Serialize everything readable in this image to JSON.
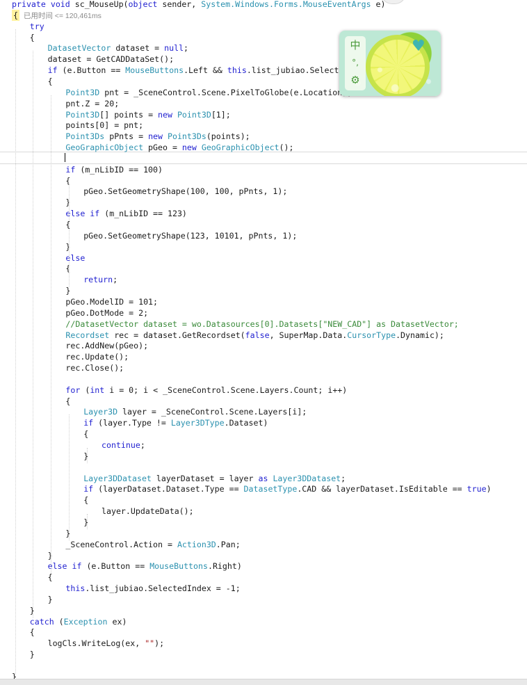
{
  "editor": {
    "inline_hint": "已用时间 <= 120,461ms",
    "lines": [
      {
        "indent": 0,
        "parts": [
          [
            "kw",
            "private void "
          ],
          [
            "",
            "sc_MouseUp("
          ],
          [
            "kw",
            "object"
          ],
          [
            "",
            " sender, "
          ],
          [
            "ty",
            "System.Windows.Forms.MouseEventArgs"
          ],
          [
            "",
            " e)"
          ]
        ]
      },
      {
        "indent": 0,
        "hint": true
      },
      {
        "indent": 1,
        "parts": [
          [
            "kw",
            "try"
          ]
        ]
      },
      {
        "indent": 1,
        "parts": [
          [
            "",
            "{"
          ]
        ]
      },
      {
        "indent": 2,
        "parts": [
          [
            "ty",
            "DatasetVector"
          ],
          [
            "",
            " dataset = "
          ],
          [
            "kw",
            "null"
          ],
          [
            "",
            ";"
          ]
        ]
      },
      {
        "indent": 2,
        "parts": [
          [
            "",
            "dataset = GetCADDataSet();"
          ]
        ]
      },
      {
        "indent": 2,
        "parts": [
          [
            "kw",
            "if"
          ],
          [
            "",
            " (e.Button == "
          ],
          [
            "ty",
            "MouseButtons"
          ],
          [
            "",
            ".Left && "
          ],
          [
            "kw",
            "this"
          ],
          [
            "",
            ".list_jubiao.SelectedInd"
          ]
        ]
      },
      {
        "indent": 2,
        "parts": [
          [
            "",
            "{"
          ]
        ]
      },
      {
        "indent": 3,
        "parts": [
          [
            "ty",
            "Point3D"
          ],
          [
            "",
            " pnt = _SceneControl.Scene.PixelToGlobe(e.Location);"
          ]
        ]
      },
      {
        "indent": 3,
        "parts": [
          [
            "",
            "pnt.Z = 20;"
          ]
        ]
      },
      {
        "indent": 3,
        "parts": [
          [
            "ty",
            "Point3D"
          ],
          [
            "",
            "[] points = "
          ],
          [
            "kw",
            "new "
          ],
          [
            "ty",
            "Point3D"
          ],
          [
            "",
            "[1];"
          ]
        ]
      },
      {
        "indent": 3,
        "parts": [
          [
            "",
            "points[0] = pnt;"
          ]
        ]
      },
      {
        "indent": 3,
        "parts": [
          [
            "ty",
            "Point3Ds"
          ],
          [
            "",
            " pPnts = "
          ],
          [
            "kw",
            "new "
          ],
          [
            "ty",
            "Point3Ds"
          ],
          [
            "",
            "(points);"
          ]
        ]
      },
      {
        "indent": 3,
        "parts": [
          [
            "ty",
            "GeoGraphicObject"
          ],
          [
            "",
            " pGeo = "
          ],
          [
            "kw",
            "new "
          ],
          [
            "ty",
            "GeoGraphicObject"
          ],
          [
            "",
            "();"
          ]
        ]
      },
      {
        "indent": 3,
        "parts": []
      },
      {
        "indent": 3,
        "parts": [
          [
            "kw",
            "if"
          ],
          [
            "",
            " (m_nLibID == 100)"
          ]
        ]
      },
      {
        "indent": 3,
        "parts": [
          [
            "",
            "{"
          ]
        ]
      },
      {
        "indent": 4,
        "parts": [
          [
            "",
            "pGeo.SetGeometryShape(100, 100, pPnts, 1);"
          ]
        ]
      },
      {
        "indent": 3,
        "parts": [
          [
            "",
            "}"
          ]
        ]
      },
      {
        "indent": 3,
        "parts": [
          [
            "kw",
            "else if"
          ],
          [
            "",
            " (m_nLibID == 123)"
          ]
        ]
      },
      {
        "indent": 3,
        "parts": [
          [
            "",
            "{"
          ]
        ]
      },
      {
        "indent": 4,
        "parts": [
          [
            "",
            "pGeo.SetGeometryShape(123, 10101, pPnts, 1);"
          ]
        ]
      },
      {
        "indent": 3,
        "parts": [
          [
            "",
            "}"
          ]
        ]
      },
      {
        "indent": 3,
        "parts": [
          [
            "kw",
            "else"
          ]
        ]
      },
      {
        "indent": 3,
        "parts": [
          [
            "",
            "{"
          ]
        ]
      },
      {
        "indent": 4,
        "parts": [
          [
            "kw",
            "return"
          ],
          [
            "",
            ";"
          ]
        ]
      },
      {
        "indent": 3,
        "parts": [
          [
            "",
            "}"
          ]
        ]
      },
      {
        "indent": 3,
        "parts": [
          [
            "",
            "pGeo.ModelID = 101;"
          ]
        ]
      },
      {
        "indent": 3,
        "parts": [
          [
            "",
            "pGeo.DotMode = 2;"
          ]
        ]
      },
      {
        "indent": 3,
        "parts": [
          [
            "cm",
            "//DatasetVector dataset = wo.Datasources[0].Datasets[\"NEW_CAD\"] as DatasetVector;"
          ]
        ]
      },
      {
        "indent": 3,
        "parts": [
          [
            "ty",
            "Recordset"
          ],
          [
            "",
            " rec = dataset.GetRecordset("
          ],
          [
            "kw",
            "false"
          ],
          [
            "",
            ", SuperMap.Data."
          ],
          [
            "ty",
            "CursorType"
          ],
          [
            "",
            ".Dynamic);"
          ]
        ]
      },
      {
        "indent": 3,
        "parts": [
          [
            "",
            "rec.AddNew(pGeo);"
          ]
        ]
      },
      {
        "indent": 3,
        "parts": [
          [
            "",
            "rec.Update();"
          ]
        ]
      },
      {
        "indent": 3,
        "parts": [
          [
            "",
            "rec.Close();"
          ]
        ]
      },
      {
        "indent": 3,
        "parts": []
      },
      {
        "indent": 3,
        "parts": [
          [
            "kw",
            "for"
          ],
          [
            "",
            " ("
          ],
          [
            "kw",
            "int"
          ],
          [
            "",
            " i = 0; i < _SceneControl.Scene.Layers.Count; i++)"
          ]
        ]
      },
      {
        "indent": 3,
        "parts": [
          [
            "",
            "{"
          ]
        ]
      },
      {
        "indent": 4,
        "parts": [
          [
            "ty",
            "Layer3D"
          ],
          [
            "",
            " layer = _SceneControl.Scene.Layers[i];"
          ]
        ]
      },
      {
        "indent": 4,
        "parts": [
          [
            "kw",
            "if"
          ],
          [
            "",
            " (layer.Type != "
          ],
          [
            "ty",
            "Layer3DType"
          ],
          [
            "",
            ".Dataset)"
          ]
        ]
      },
      {
        "indent": 4,
        "parts": [
          [
            "",
            "{"
          ]
        ]
      },
      {
        "indent": 5,
        "parts": [
          [
            "kw",
            "continue"
          ],
          [
            "",
            ";"
          ]
        ]
      },
      {
        "indent": 4,
        "parts": [
          [
            "",
            "}"
          ]
        ]
      },
      {
        "indent": 4,
        "parts": []
      },
      {
        "indent": 4,
        "parts": [
          [
            "ty",
            "Layer3DDataset"
          ],
          [
            "",
            " layerDataset = layer "
          ],
          [
            "kw",
            "as "
          ],
          [
            "ty",
            "Layer3DDataset"
          ],
          [
            "",
            ";"
          ]
        ]
      },
      {
        "indent": 4,
        "parts": [
          [
            "kw",
            "if"
          ],
          [
            "",
            " (layerDataset.Dataset.Type == "
          ],
          [
            "ty",
            "DatasetType"
          ],
          [
            "",
            ".CAD && layerDataset.IsEditable == "
          ],
          [
            "kw",
            "true"
          ],
          [
            "",
            ")"
          ]
        ]
      },
      {
        "indent": 4,
        "parts": [
          [
            "",
            "{"
          ]
        ]
      },
      {
        "indent": 5,
        "parts": [
          [
            "",
            "layer.UpdateData();"
          ]
        ]
      },
      {
        "indent": 4,
        "parts": [
          [
            "",
            "}"
          ]
        ]
      },
      {
        "indent": 3,
        "parts": [
          [
            "",
            "}"
          ]
        ]
      },
      {
        "indent": 3,
        "parts": [
          [
            "",
            "_SceneControl.Action = "
          ],
          [
            "ty",
            "Action3D"
          ],
          [
            "",
            ".Pan;"
          ]
        ]
      },
      {
        "indent": 2,
        "parts": [
          [
            "",
            "}"
          ]
        ]
      },
      {
        "indent": 2,
        "parts": [
          [
            "kw",
            "else if"
          ],
          [
            "",
            " (e.Button == "
          ],
          [
            "ty",
            "MouseButtons"
          ],
          [
            "",
            ".Right)"
          ]
        ]
      },
      {
        "indent": 2,
        "parts": [
          [
            "",
            "{"
          ]
        ]
      },
      {
        "indent": 3,
        "parts": [
          [
            "kw",
            "this"
          ],
          [
            "",
            ".list_jubiao.SelectedIndex = -1;"
          ]
        ]
      },
      {
        "indent": 2,
        "parts": [
          [
            "",
            "}"
          ]
        ]
      },
      {
        "indent": 1,
        "parts": [
          [
            "",
            "}"
          ]
        ]
      },
      {
        "indent": 1,
        "parts": [
          [
            "kw",
            "catch"
          ],
          [
            "",
            " ("
          ],
          [
            "ty",
            "Exception"
          ],
          [
            "",
            " ex)"
          ]
        ]
      },
      {
        "indent": 1,
        "parts": [
          [
            "",
            "{"
          ]
        ]
      },
      {
        "indent": 2,
        "parts": [
          [
            "",
            "logCls.WriteLog(ex, "
          ],
          [
            "st",
            "\"\""
          ],
          [
            "",
            ");"
          ]
        ]
      },
      {
        "indent": 1,
        "parts": [
          [
            "",
            "}"
          ]
        ]
      },
      {
        "indent": 0,
        "parts": []
      },
      {
        "indent": 0,
        "parts": [
          [
            "",
            "}"
          ]
        ]
      }
    ]
  },
  "ime_panel": {
    "mode_label": "中",
    "punct_label": "°,",
    "settings_icon": "gear-icon"
  }
}
